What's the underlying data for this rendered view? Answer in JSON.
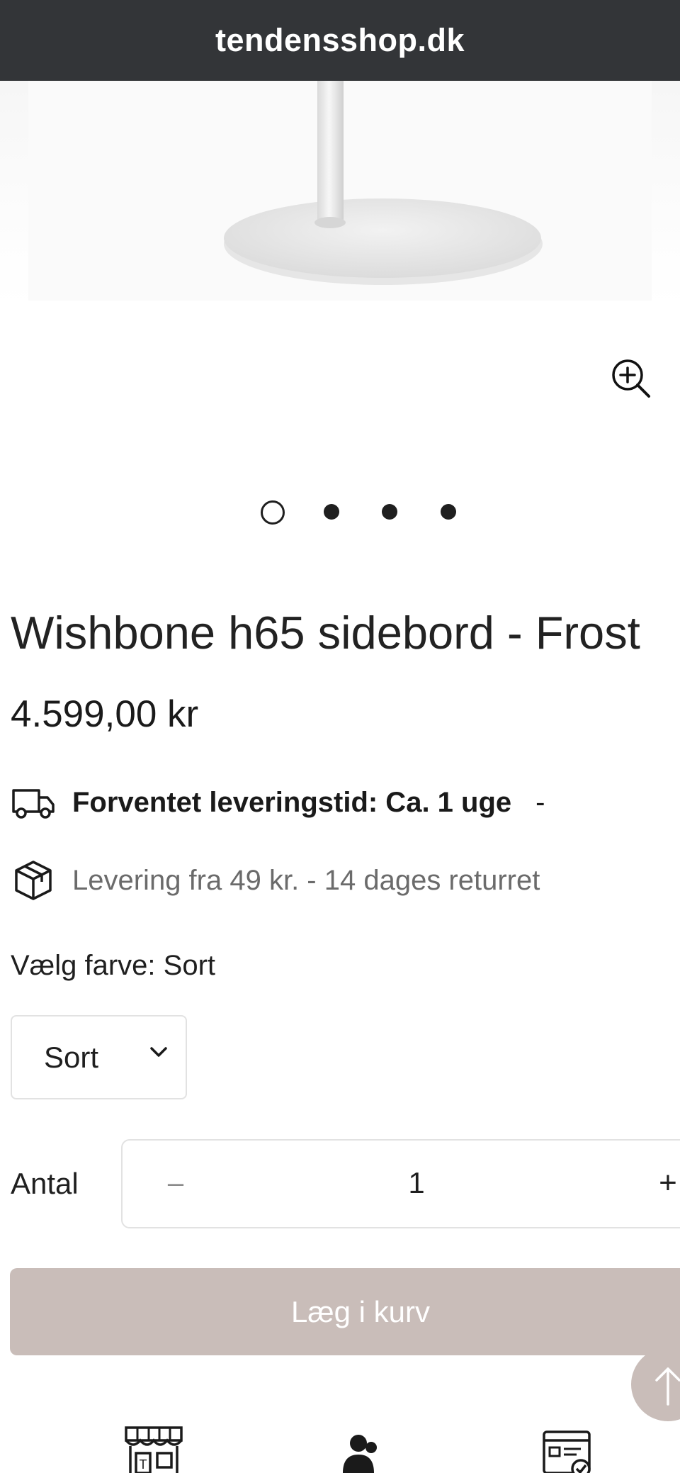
{
  "browser": {
    "domain": "tendensshop.dk"
  },
  "gallery": {
    "zoom_icon": "zoom-in-icon",
    "slide_count": 4,
    "active_slide": 1
  },
  "product": {
    "title": "Wishbone h65 sidebord - Frost",
    "price": "4.599,00 kr"
  },
  "info": {
    "delivery_icon": "truck-icon",
    "delivery_text": "Forventet leveringstid: Ca. 1 uge",
    "delivery_dash": "-",
    "shipping_icon": "package-icon",
    "shipping_text": "Levering fra 49 kr. - 14 dages returret"
  },
  "variant": {
    "label": "Vælg farve: Sort",
    "selected": "Sort"
  },
  "quantity": {
    "label": "Antal",
    "minus": "–",
    "value": "1",
    "plus": "+"
  },
  "cart": {
    "button_label": "Læg i kurv"
  },
  "footer": {
    "icons": [
      "store-icon",
      "users-icon",
      "order-check-icon"
    ]
  },
  "colors": {
    "address_bar": "#333538",
    "accent_button": "#c9bdb9",
    "text": "#1f1f1f",
    "muted_text": "#6b6b6b"
  }
}
